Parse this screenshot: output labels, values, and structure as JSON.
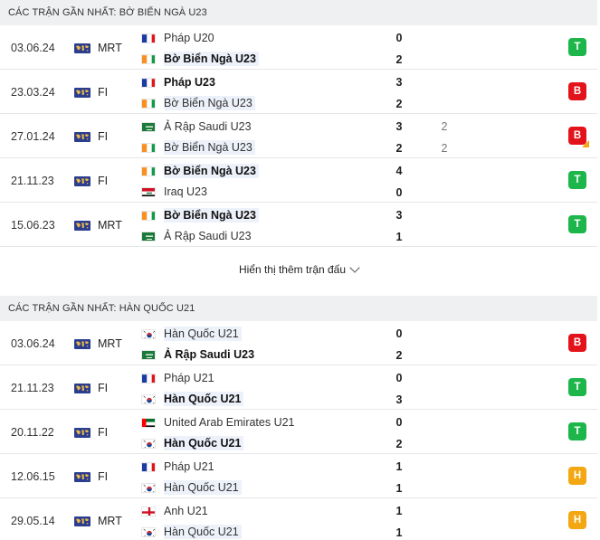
{
  "sections": [
    {
      "title": "CÁC TRẬN GẦN NHẤT: BỜ BIỂN NGÀ U23",
      "matches": [
        {
          "date": "03.06.24",
          "competition": "MRT",
          "home": {
            "name": "Pháp U20",
            "flag": "fr",
            "score": "0",
            "win": false,
            "highlight": false
          },
          "away": {
            "name": "Bờ Biển Ngà U23",
            "flag": "ci",
            "score": "2",
            "win": true,
            "highlight": true
          },
          "result": "T"
        },
        {
          "date": "23.03.24",
          "competition": "FI",
          "home": {
            "name": "Pháp U23",
            "flag": "fr",
            "score": "3",
            "win": true,
            "highlight": false
          },
          "away": {
            "name": "Bờ Biển Ngà U23",
            "flag": "ci",
            "score": "2",
            "win": false,
            "highlight": true
          },
          "result": "B"
        },
        {
          "date": "27.01.24",
          "competition": "FI",
          "home": {
            "name": "Ả Rập Saudi U23",
            "flag": "sa",
            "score": "3",
            "pen": "2",
            "win": false,
            "highlight": false
          },
          "away": {
            "name": "Bờ Biển Ngà U23",
            "flag": "ci",
            "score": "2",
            "pen": "2",
            "win": false,
            "highlight": true
          },
          "result": "B",
          "corner": true
        },
        {
          "date": "21.11.23",
          "competition": "FI",
          "home": {
            "name": "Bờ Biển Ngà U23",
            "flag": "ci",
            "score": "4",
            "win": true,
            "highlight": true
          },
          "away": {
            "name": "Iraq U23",
            "flag": "iq",
            "score": "0",
            "win": false,
            "highlight": false
          },
          "result": "T"
        },
        {
          "date": "15.06.23",
          "competition": "MRT",
          "home": {
            "name": "Bờ Biển Ngà U23",
            "flag": "ci",
            "score": "3",
            "win": true,
            "highlight": true
          },
          "away": {
            "name": "Ả Rập Saudi U23",
            "flag": "sa",
            "score": "1",
            "win": false,
            "highlight": false
          },
          "result": "T"
        }
      ],
      "more_label": "Hiển thị thêm trận đấu"
    },
    {
      "title": "CÁC TRẬN GẦN NHẤT: HÀN QUỐC U21",
      "matches": [
        {
          "date": "03.06.24",
          "competition": "MRT",
          "home": {
            "name": "Hàn Quốc U21",
            "flag": "kr",
            "score": "0",
            "win": false,
            "highlight": true
          },
          "away": {
            "name": "Ả Rập Saudi U23",
            "flag": "sa",
            "score": "2",
            "win": true,
            "highlight": false
          },
          "result": "B"
        },
        {
          "date": "21.11.23",
          "competition": "FI",
          "home": {
            "name": "Pháp U21",
            "flag": "fr",
            "score": "0",
            "win": false,
            "highlight": false
          },
          "away": {
            "name": "Hàn Quốc U21",
            "flag": "kr",
            "score": "3",
            "win": true,
            "highlight": true
          },
          "result": "T"
        },
        {
          "date": "20.11.22",
          "competition": "FI",
          "home": {
            "name": "United Arab Emirates U21",
            "flag": "ae",
            "score": "0",
            "win": false,
            "highlight": false
          },
          "away": {
            "name": "Hàn Quốc U21",
            "flag": "kr",
            "score": "2",
            "win": true,
            "highlight": true
          },
          "result": "T"
        },
        {
          "date": "12.06.15",
          "competition": "FI",
          "home": {
            "name": "Pháp U21",
            "flag": "fr",
            "score": "1",
            "win": false,
            "highlight": false
          },
          "away": {
            "name": "Hàn Quốc U21",
            "flag": "kr",
            "score": "1",
            "win": false,
            "highlight": true
          },
          "result": "H"
        },
        {
          "date": "29.05.14",
          "competition": "MRT",
          "home": {
            "name": "Anh U21",
            "flag": "en",
            "score": "1",
            "win": false,
            "highlight": false
          },
          "away": {
            "name": "Hàn Quốc U21",
            "flag": "kr",
            "score": "1",
            "win": false,
            "highlight": true
          },
          "result": "H"
        }
      ]
    }
  ],
  "colors": {
    "win": "#1cb64b",
    "loss": "#e3131b",
    "draw": "#f3a712",
    "header_bg": "#eef0f2",
    "highlight_bg": "#edf1fa"
  },
  "icons": {
    "competition": "world-map-icon",
    "more": "chevron-down-icon"
  }
}
